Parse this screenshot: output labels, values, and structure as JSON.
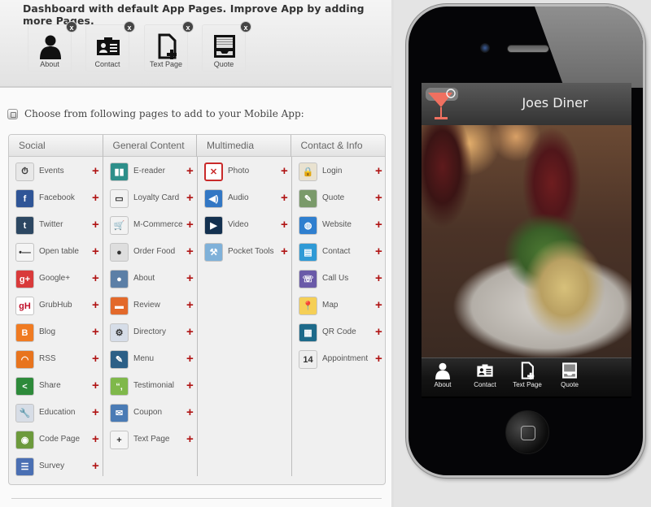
{
  "dashboard": {
    "title": "Dashboard with default App Pages. Improve App by adding more Pages.",
    "default_pages": [
      {
        "label": "About",
        "icon": "person-icon"
      },
      {
        "label": "Contact",
        "icon": "contact-card-icon"
      },
      {
        "label": "Text Page",
        "icon": "text-page-icon"
      },
      {
        "label": "Quote",
        "icon": "quote-icon"
      }
    ],
    "remove_label": "x"
  },
  "chooser": {
    "text": "Choose from following pages to add to your Mobile App:",
    "add_label": "+",
    "tabs": [
      "Social",
      "General Content",
      "Multimedia",
      "Contact & Info"
    ],
    "columns": [
      {
        "name": "Social",
        "items": [
          {
            "label": "Events",
            "icon": "events-icon",
            "color": "#e8e8e8"
          },
          {
            "label": "Facebook",
            "icon": "facebook-icon",
            "color": "#2f5597"
          },
          {
            "label": "Twitter",
            "icon": "tumblr-icon",
            "color": "#2c4762"
          },
          {
            "label": "Open table",
            "icon": "opentable-icon",
            "color": "#f4f4f4"
          },
          {
            "label": "Google+",
            "icon": "google-plus-icon",
            "color": "#d93a3a"
          },
          {
            "label": "GrubHub",
            "icon": "grubhub-icon",
            "color": "#ffffff"
          },
          {
            "label": "Blog",
            "icon": "blogger-icon",
            "color": "#f07b22"
          },
          {
            "label": "RSS",
            "icon": "rss-icon",
            "color": "#e8741e"
          },
          {
            "label": "Share",
            "icon": "share-icon",
            "color": "#2d8a3a"
          },
          {
            "label": "Education",
            "icon": "education-icon",
            "color": "#d7dde6"
          },
          {
            "label": "Code Page",
            "icon": "code-page-icon",
            "color": "#6c9a3c"
          },
          {
            "label": "Survey",
            "icon": "survey-icon",
            "color": "#4a6fb3"
          }
        ]
      },
      {
        "name": "General Content",
        "items": [
          {
            "label": "E-reader",
            "icon": "ereader-icon",
            "color": "#2d8f8a"
          },
          {
            "label": "Loyalty Card",
            "icon": "loyalty-card-icon",
            "color": "#f2f2f2"
          },
          {
            "label": "M-Commerce",
            "icon": "cart-icon",
            "color": "#f2f2f2"
          },
          {
            "label": "Order Food",
            "icon": "order-food-icon",
            "color": "#dedede"
          },
          {
            "label": "About",
            "icon": "person-icon",
            "color": "#5c7fa6"
          },
          {
            "label": "Review",
            "icon": "review-icon",
            "color": "#e3692a"
          },
          {
            "label": "Directory",
            "icon": "directory-icon",
            "color": "#d6dde8"
          },
          {
            "label": "Menu",
            "icon": "menu-icon",
            "color": "#2c5f86"
          },
          {
            "label": "Testimonial",
            "icon": "testimonial-icon",
            "color": "#7fb84a"
          },
          {
            "label": "Coupon",
            "icon": "coupon-icon",
            "color": "#4a7bb5"
          },
          {
            "label": "Text Page",
            "icon": "text-page-icon",
            "color": "#f4f4f4"
          }
        ]
      },
      {
        "name": "Multimedia",
        "items": [
          {
            "label": "Photo",
            "icon": "photo-icon",
            "color": "#c92a2a"
          },
          {
            "label": "Audio",
            "icon": "audio-icon",
            "color": "#3277c4"
          },
          {
            "label": "Video",
            "icon": "video-icon",
            "color": "#13304f"
          },
          {
            "label": "Pocket Tools",
            "icon": "pocket-tools-icon",
            "color": "#7fb1d9"
          }
        ]
      },
      {
        "name": "Contact & Info",
        "items": [
          {
            "label": "Login",
            "icon": "lock-icon",
            "color": "#e9e2d0"
          },
          {
            "label": "Quote",
            "icon": "quote-edit-icon",
            "color": "#7a9a6a"
          },
          {
            "label": "Website",
            "icon": "globe-icon",
            "color": "#2f7fcf"
          },
          {
            "label": "Contact",
            "icon": "contact-card-icon",
            "color": "#2f9ad6"
          },
          {
            "label": "Call Us",
            "icon": "phone-book-icon",
            "color": "#6a5aa8"
          },
          {
            "label": "Map",
            "icon": "map-icon",
            "color": "#f5cf56"
          },
          {
            "label": "QR Code",
            "icon": "qr-code-icon",
            "color": "#1d6a8a"
          },
          {
            "label": "Appointment",
            "icon": "calendar-icon",
            "color": "#eeeeee",
            "calendar_day": "14"
          }
        ]
      }
    ]
  },
  "phone": {
    "app_title": "Joes Diner",
    "accent": "#f07060",
    "tabbar": [
      {
        "label": "About",
        "icon": "person-icon"
      },
      {
        "label": "Contact",
        "icon": "contact-card-icon"
      },
      {
        "label": "Text Page",
        "icon": "text-page-icon"
      },
      {
        "label": "Quote",
        "icon": "quote-icon"
      }
    ]
  }
}
